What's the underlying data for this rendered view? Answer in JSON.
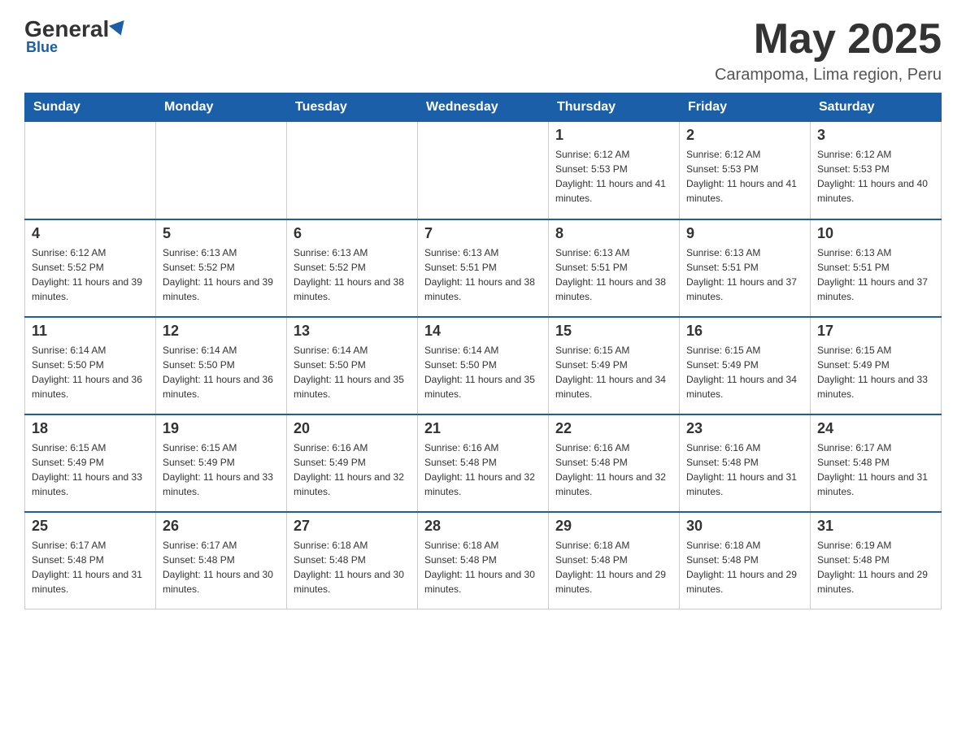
{
  "header": {
    "logo_general": "General",
    "logo_blue": "Blue",
    "month_title": "May 2025",
    "location": "Carampoma, Lima region, Peru"
  },
  "weekdays": [
    "Sunday",
    "Monday",
    "Tuesday",
    "Wednesday",
    "Thursday",
    "Friday",
    "Saturday"
  ],
  "weeks": [
    [
      {
        "day": "",
        "sunrise": "",
        "sunset": "",
        "daylight": ""
      },
      {
        "day": "",
        "sunrise": "",
        "sunset": "",
        "daylight": ""
      },
      {
        "day": "",
        "sunrise": "",
        "sunset": "",
        "daylight": ""
      },
      {
        "day": "",
        "sunrise": "",
        "sunset": "",
        "daylight": ""
      },
      {
        "day": "1",
        "sunrise": "Sunrise: 6:12 AM",
        "sunset": "Sunset: 5:53 PM",
        "daylight": "Daylight: 11 hours and 41 minutes."
      },
      {
        "day": "2",
        "sunrise": "Sunrise: 6:12 AM",
        "sunset": "Sunset: 5:53 PM",
        "daylight": "Daylight: 11 hours and 41 minutes."
      },
      {
        "day": "3",
        "sunrise": "Sunrise: 6:12 AM",
        "sunset": "Sunset: 5:53 PM",
        "daylight": "Daylight: 11 hours and 40 minutes."
      }
    ],
    [
      {
        "day": "4",
        "sunrise": "Sunrise: 6:12 AM",
        "sunset": "Sunset: 5:52 PM",
        "daylight": "Daylight: 11 hours and 39 minutes."
      },
      {
        "day": "5",
        "sunrise": "Sunrise: 6:13 AM",
        "sunset": "Sunset: 5:52 PM",
        "daylight": "Daylight: 11 hours and 39 minutes."
      },
      {
        "day": "6",
        "sunrise": "Sunrise: 6:13 AM",
        "sunset": "Sunset: 5:52 PM",
        "daylight": "Daylight: 11 hours and 38 minutes."
      },
      {
        "day": "7",
        "sunrise": "Sunrise: 6:13 AM",
        "sunset": "Sunset: 5:51 PM",
        "daylight": "Daylight: 11 hours and 38 minutes."
      },
      {
        "day": "8",
        "sunrise": "Sunrise: 6:13 AM",
        "sunset": "Sunset: 5:51 PM",
        "daylight": "Daylight: 11 hours and 38 minutes."
      },
      {
        "day": "9",
        "sunrise": "Sunrise: 6:13 AM",
        "sunset": "Sunset: 5:51 PM",
        "daylight": "Daylight: 11 hours and 37 minutes."
      },
      {
        "day": "10",
        "sunrise": "Sunrise: 6:13 AM",
        "sunset": "Sunset: 5:51 PM",
        "daylight": "Daylight: 11 hours and 37 minutes."
      }
    ],
    [
      {
        "day": "11",
        "sunrise": "Sunrise: 6:14 AM",
        "sunset": "Sunset: 5:50 PM",
        "daylight": "Daylight: 11 hours and 36 minutes."
      },
      {
        "day": "12",
        "sunrise": "Sunrise: 6:14 AM",
        "sunset": "Sunset: 5:50 PM",
        "daylight": "Daylight: 11 hours and 36 minutes."
      },
      {
        "day": "13",
        "sunrise": "Sunrise: 6:14 AM",
        "sunset": "Sunset: 5:50 PM",
        "daylight": "Daylight: 11 hours and 35 minutes."
      },
      {
        "day": "14",
        "sunrise": "Sunrise: 6:14 AM",
        "sunset": "Sunset: 5:50 PM",
        "daylight": "Daylight: 11 hours and 35 minutes."
      },
      {
        "day": "15",
        "sunrise": "Sunrise: 6:15 AM",
        "sunset": "Sunset: 5:49 PM",
        "daylight": "Daylight: 11 hours and 34 minutes."
      },
      {
        "day": "16",
        "sunrise": "Sunrise: 6:15 AM",
        "sunset": "Sunset: 5:49 PM",
        "daylight": "Daylight: 11 hours and 34 minutes."
      },
      {
        "day": "17",
        "sunrise": "Sunrise: 6:15 AM",
        "sunset": "Sunset: 5:49 PM",
        "daylight": "Daylight: 11 hours and 33 minutes."
      }
    ],
    [
      {
        "day": "18",
        "sunrise": "Sunrise: 6:15 AM",
        "sunset": "Sunset: 5:49 PM",
        "daylight": "Daylight: 11 hours and 33 minutes."
      },
      {
        "day": "19",
        "sunrise": "Sunrise: 6:15 AM",
        "sunset": "Sunset: 5:49 PM",
        "daylight": "Daylight: 11 hours and 33 minutes."
      },
      {
        "day": "20",
        "sunrise": "Sunrise: 6:16 AM",
        "sunset": "Sunset: 5:49 PM",
        "daylight": "Daylight: 11 hours and 32 minutes."
      },
      {
        "day": "21",
        "sunrise": "Sunrise: 6:16 AM",
        "sunset": "Sunset: 5:48 PM",
        "daylight": "Daylight: 11 hours and 32 minutes."
      },
      {
        "day": "22",
        "sunrise": "Sunrise: 6:16 AM",
        "sunset": "Sunset: 5:48 PM",
        "daylight": "Daylight: 11 hours and 32 minutes."
      },
      {
        "day": "23",
        "sunrise": "Sunrise: 6:16 AM",
        "sunset": "Sunset: 5:48 PM",
        "daylight": "Daylight: 11 hours and 31 minutes."
      },
      {
        "day": "24",
        "sunrise": "Sunrise: 6:17 AM",
        "sunset": "Sunset: 5:48 PM",
        "daylight": "Daylight: 11 hours and 31 minutes."
      }
    ],
    [
      {
        "day": "25",
        "sunrise": "Sunrise: 6:17 AM",
        "sunset": "Sunset: 5:48 PM",
        "daylight": "Daylight: 11 hours and 31 minutes."
      },
      {
        "day": "26",
        "sunrise": "Sunrise: 6:17 AM",
        "sunset": "Sunset: 5:48 PM",
        "daylight": "Daylight: 11 hours and 30 minutes."
      },
      {
        "day": "27",
        "sunrise": "Sunrise: 6:18 AM",
        "sunset": "Sunset: 5:48 PM",
        "daylight": "Daylight: 11 hours and 30 minutes."
      },
      {
        "day": "28",
        "sunrise": "Sunrise: 6:18 AM",
        "sunset": "Sunset: 5:48 PM",
        "daylight": "Daylight: 11 hours and 30 minutes."
      },
      {
        "day": "29",
        "sunrise": "Sunrise: 6:18 AM",
        "sunset": "Sunset: 5:48 PM",
        "daylight": "Daylight: 11 hours and 29 minutes."
      },
      {
        "day": "30",
        "sunrise": "Sunrise: 6:18 AM",
        "sunset": "Sunset: 5:48 PM",
        "daylight": "Daylight: 11 hours and 29 minutes."
      },
      {
        "day": "31",
        "sunrise": "Sunrise: 6:19 AM",
        "sunset": "Sunset: 5:48 PM",
        "daylight": "Daylight: 11 hours and 29 minutes."
      }
    ]
  ]
}
